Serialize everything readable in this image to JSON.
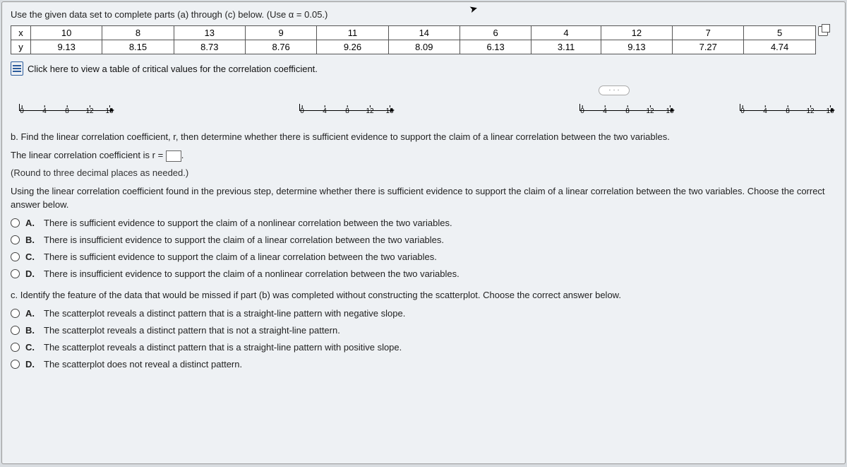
{
  "prompt": "Use the given data set to complete parts (a) through (c) below. (Use α = 0.05.)",
  "table": {
    "row_labels": [
      "x",
      "y"
    ],
    "x": [
      "10",
      "8",
      "13",
      "9",
      "11",
      "14",
      "6",
      "4",
      "12",
      "7",
      "5"
    ],
    "y": [
      "9.13",
      "8.15",
      "8.73",
      "8.76",
      "9.26",
      "8.09",
      "6.13",
      "3.11",
      "9.13",
      "7.27",
      "4.74"
    ]
  },
  "link_text": "Click here to view a table of critical values for the correlation coefficient.",
  "axis_ticks": [
    "0",
    "4",
    "8",
    "12",
    "16"
  ],
  "dots": "· · ·",
  "partb_q": "b. Find the linear correlation coefficient, r, then determine whether there is sufficient evidence to support the claim of a linear correlation between the two variables.",
  "r_line_prefix": "The linear correlation coefficient is r = ",
  "r_line_suffix": ".",
  "hint": "(Round to three decimal places as needed.)",
  "followup": "Using the linear correlation coefficient found in the previous step, determine whether there is sufficient evidence to support the claim of a linear correlation between the two variables. Choose the correct answer below.",
  "choices_b": {
    "A": "There is sufficient evidence to support the claim of a nonlinear correlation between the two variables.",
    "B": "There is insufficient evidence to support the claim of a linear correlation between the two variables.",
    "C": "There is sufficient evidence to support the claim of a linear correlation between the two variables.",
    "D": "There is insufficient evidence to support the claim of a nonlinear correlation between the two variables."
  },
  "partc_q": "c. Identify the feature of the data that would be missed if part (b) was completed without constructing the scatterplot. Choose the correct answer below.",
  "choices_c": {
    "A": "The scatterplot reveals a distinct pattern that is a straight-line pattern with negative slope.",
    "B": "The scatterplot reveals a distinct pattern that is not a straight-line pattern.",
    "C": "The scatterplot reveals a distinct pattern that is a straight-line pattern with positive slope.",
    "D": "The scatterplot does not reveal a distinct pattern."
  },
  "labels": {
    "A": "A.",
    "B": "B.",
    "C": "C.",
    "D": "D."
  }
}
